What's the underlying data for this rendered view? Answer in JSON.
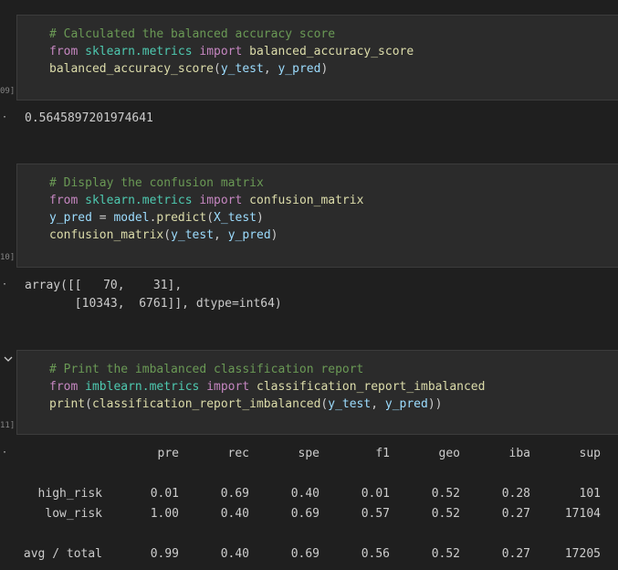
{
  "cells": [
    {
      "exec_count": "09]",
      "lines": [
        [
          {
            "t": "comment",
            "v": "# Calculated the balanced accuracy score"
          }
        ],
        [
          {
            "t": "kw",
            "v": "from"
          },
          {
            "t": "punc",
            "v": " "
          },
          {
            "t": "mod",
            "v": "sklearn.metrics"
          },
          {
            "t": "punc",
            "v": " "
          },
          {
            "t": "kw",
            "v": "import"
          },
          {
            "t": "punc",
            "v": " "
          },
          {
            "t": "fn",
            "v": "balanced_accuracy_score"
          }
        ],
        [
          {
            "t": "fn",
            "v": "balanced_accuracy_score"
          },
          {
            "t": "punc",
            "v": "("
          },
          {
            "t": "var",
            "v": "y_test"
          },
          {
            "t": "punc",
            "v": ", "
          },
          {
            "t": "var",
            "v": "y_pred"
          },
          {
            "t": "punc",
            "v": ")"
          }
        ]
      ],
      "output": [
        "0.5645897201974641"
      ]
    },
    {
      "exec_count": "10]",
      "lines": [
        [
          {
            "t": "comment",
            "v": "# Display the confusion matrix"
          }
        ],
        [
          {
            "t": "kw",
            "v": "from"
          },
          {
            "t": "punc",
            "v": " "
          },
          {
            "t": "mod",
            "v": "sklearn.metrics"
          },
          {
            "t": "punc",
            "v": " "
          },
          {
            "t": "kw",
            "v": "import"
          },
          {
            "t": "punc",
            "v": " "
          },
          {
            "t": "fn",
            "v": "confusion_matrix"
          }
        ],
        [
          {
            "t": "var",
            "v": "y_pred"
          },
          {
            "t": "punc",
            "v": " = "
          },
          {
            "t": "var",
            "v": "model"
          },
          {
            "t": "punc",
            "v": "."
          },
          {
            "t": "fn",
            "v": "predict"
          },
          {
            "t": "punc",
            "v": "("
          },
          {
            "t": "var",
            "v": "X_test"
          },
          {
            "t": "punc",
            "v": ")"
          }
        ],
        [
          {
            "t": "fn",
            "v": "confusion_matrix"
          },
          {
            "t": "punc",
            "v": "("
          },
          {
            "t": "var",
            "v": "y_test"
          },
          {
            "t": "punc",
            "v": ", "
          },
          {
            "t": "var",
            "v": "y_pred"
          },
          {
            "t": "punc",
            "v": ")"
          }
        ]
      ],
      "output": [
        "array([[   70,    31],",
        "       [10343,  6761]], dtype=int64)"
      ]
    },
    {
      "exec_count": "11]",
      "lines": [
        [
          {
            "t": "comment",
            "v": "# Print the imbalanced classification report"
          }
        ],
        [
          {
            "t": "kw",
            "v": "from"
          },
          {
            "t": "punc",
            "v": " "
          },
          {
            "t": "mod",
            "v": "imblearn.metrics"
          },
          {
            "t": "punc",
            "v": " "
          },
          {
            "t": "kw",
            "v": "import"
          },
          {
            "t": "punc",
            "v": " "
          },
          {
            "t": "fn",
            "v": "classification_report_imbalanced"
          }
        ],
        [
          {
            "t": "fn",
            "v": "print"
          },
          {
            "t": "punc",
            "v": "("
          },
          {
            "t": "fn",
            "v": "classification_report_imbalanced"
          },
          {
            "t": "punc",
            "v": "("
          },
          {
            "t": "var",
            "v": "y_test"
          },
          {
            "t": "punc",
            "v": ", "
          },
          {
            "t": "var",
            "v": "y_pred"
          },
          {
            "t": "punc",
            "v": "))"
          }
        ]
      ]
    }
  ],
  "output_marker": "·",
  "report": {
    "headers": [
      "pre",
      "rec",
      "spe",
      "f1",
      "geo",
      "iba",
      "sup"
    ],
    "rows": [
      {
        "label": "high_risk",
        "values": [
          "0.01",
          "0.69",
          "0.40",
          "0.01",
          "0.52",
          "0.28",
          "101"
        ]
      },
      {
        "label": "low_risk",
        "values": [
          "1.00",
          "0.40",
          "0.69",
          "0.57",
          "0.52",
          "0.27",
          "17104"
        ]
      },
      {
        "label": "avg / total",
        "values": [
          "0.99",
          "0.40",
          "0.69",
          "0.56",
          "0.52",
          "0.27",
          "17205"
        ]
      }
    ]
  }
}
